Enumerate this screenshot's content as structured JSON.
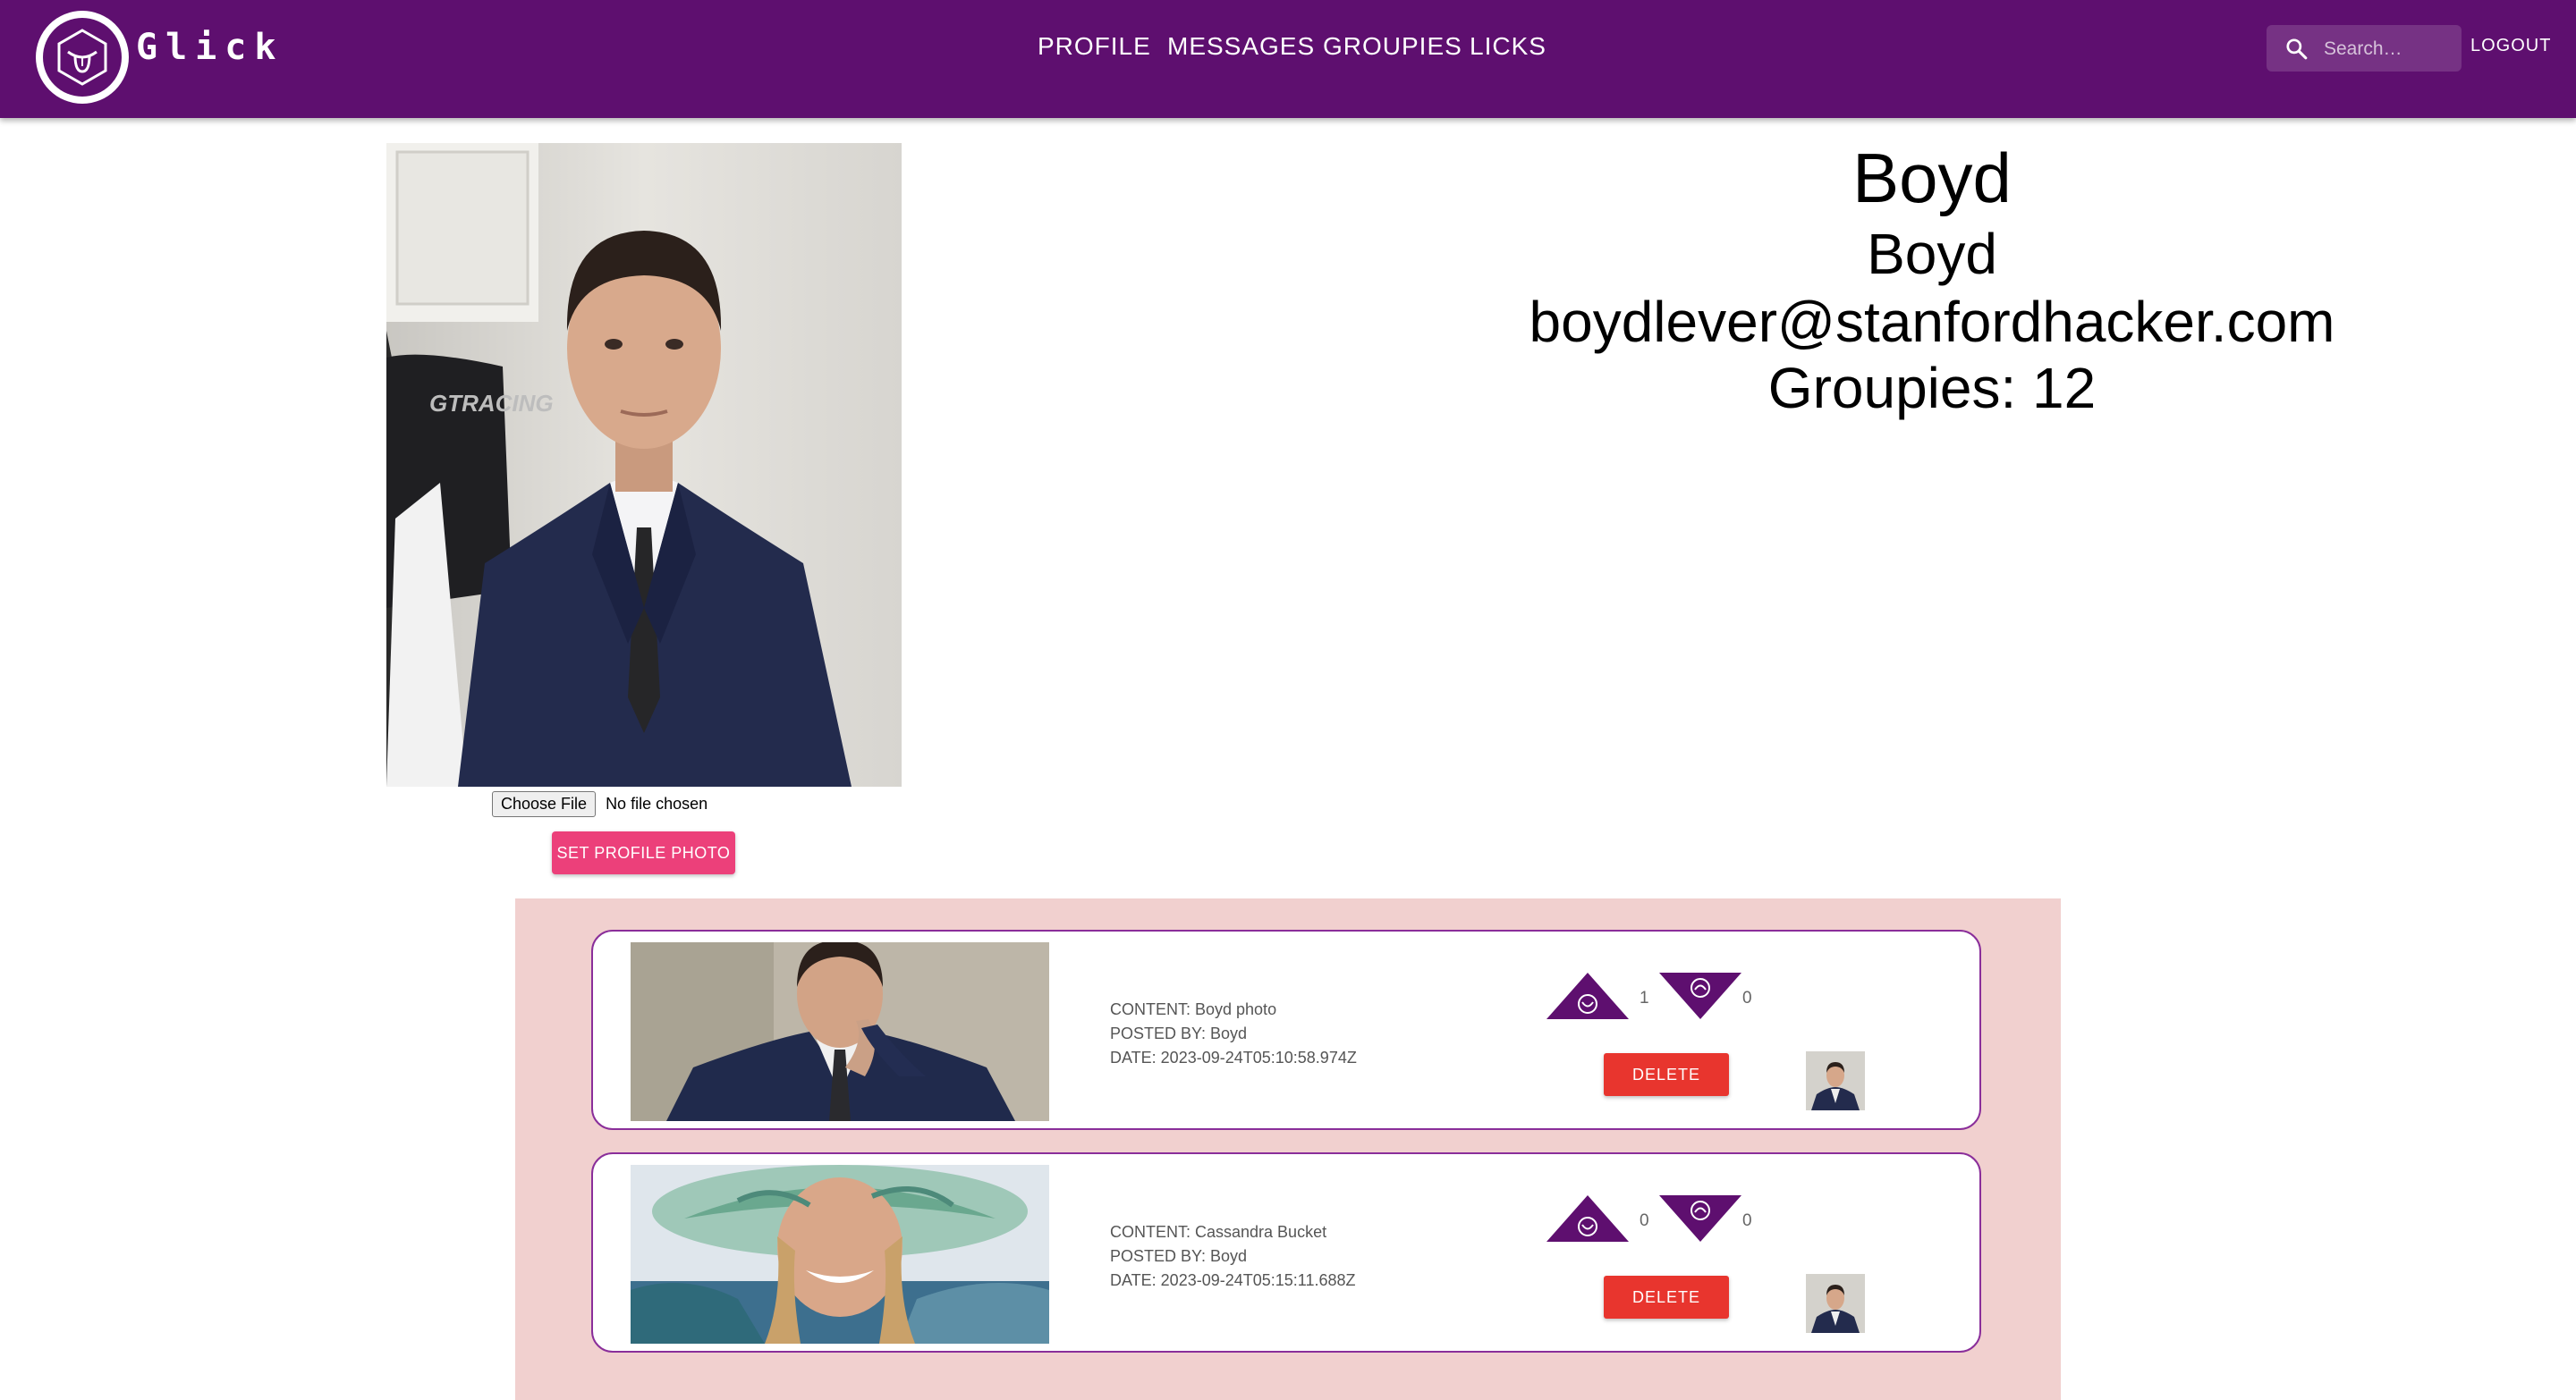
{
  "header": {
    "brand": "Glick",
    "logo_icon": "tongue-hexagon-logo-icon",
    "nav": [
      "PROFILE",
      "MESSAGES",
      "GROUPIES",
      "LICKS"
    ],
    "search_placeholder": "Search…",
    "logout_label": "LOGOUT",
    "colors": {
      "bar": "#5e0f6f",
      "text": "#ffffff"
    }
  },
  "profile": {
    "photo_icon": "man-in-suit-photo",
    "file_button": "Choose File",
    "file_status": "No file chosen",
    "set_photo_label": "SET PROFILE PHOTO",
    "display_name": "Boyd",
    "username": "Boyd",
    "email": "boydlever@stanfordhacker.com",
    "groupies_label": "Groupies: 12"
  },
  "posts": [
    {
      "content": "CONTENT: Boyd photo",
      "posted_by": "POSTED BY: Boyd",
      "date": "DATE: 2023-09-24T05:10:58.974Z",
      "up_count": "1",
      "down_count": "0",
      "delete_label": "DELETE"
    },
    {
      "content": "CONTENT: Cassandra Bucket",
      "posted_by": "POSTED BY: Boyd",
      "date": "DATE: 2023-09-24T05:15:11.688Z",
      "up_count": "0",
      "down_count": "0",
      "delete_label": "DELETE"
    }
  ],
  "colors": {
    "feed_background": "#f1d0cf",
    "post_border": "#8a2e9a",
    "delete_button": "#e8352e",
    "set_photo_button": "#ec407a",
    "vote_triangle": "#5e0f6f"
  }
}
